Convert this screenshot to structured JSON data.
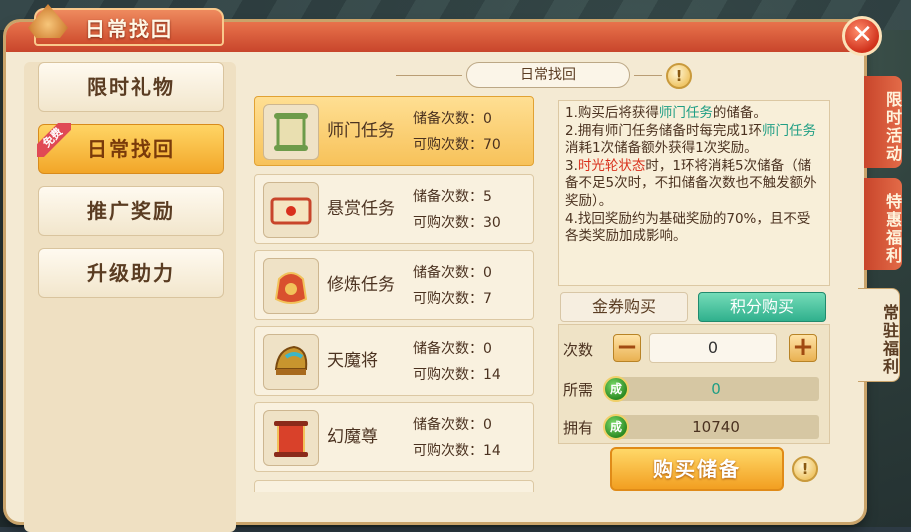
{
  "window": {
    "title": "日常找回",
    "close_symbol": "✕"
  },
  "left_menu": {
    "items": [
      {
        "label": "限时礼物",
        "active": false
      },
      {
        "label": "日常找回",
        "active": true,
        "badge": "免费"
      },
      {
        "label": "推广奖励",
        "active": false
      },
      {
        "label": "升级助力",
        "active": false
      }
    ]
  },
  "section_title": "日常找回",
  "tasks": [
    {
      "name": "师门任务",
      "stored_label": "储备次数：",
      "stored": "0",
      "buyable_label": "可购次数：",
      "buyable": "70",
      "icon": "scroll-icon",
      "active": true
    },
    {
      "name": "悬赏任务",
      "stored_label": "储备次数：",
      "stored": "5",
      "buyable_label": "可购次数：",
      "buyable": "30",
      "icon": "bounty-scroll-icon",
      "active": false
    },
    {
      "name": "修炼任务",
      "stored_label": "储备次数：",
      "stored": "0",
      "buyable_label": "可购次数：",
      "buyable": "7",
      "icon": "cultivation-pouch-icon",
      "active": false
    },
    {
      "name": "天魔将",
      "stored_label": "储备次数：",
      "stored": "0",
      "buyable_label": "可购次数：",
      "buyable": "14",
      "icon": "demon-helmet-icon",
      "active": false
    },
    {
      "name": "幻魔尊",
      "stored_label": "储备次数：",
      "stored": "0",
      "buyable_label": "可购次数：",
      "buyable": "14",
      "icon": "red-scroll-icon",
      "active": false
    }
  ],
  "description": {
    "l1a": "1.购买后将获得",
    "l1b": "师门任务",
    "l1c": "的储备。",
    "l2a": "2.拥有师门任务储备时每完成1环",
    "l2b": "师门任务",
    "l2c": "消耗1次储备额外获得1次奖励。",
    "l3a": "3.",
    "l3b": "时光轮状态",
    "l3c": "时，1环将消耗5次储备（储备不足5次时，不扣储备次数也不触发额外奖励）。",
    "l4": "4.找回奖励约为基础奖励的70%，且不受各类奖励加成影响。"
  },
  "buy_tabs": {
    "gold": "金券购买",
    "points": "积分购买",
    "active": "points"
  },
  "buy": {
    "count_label": "次数",
    "count_value": "0",
    "minus": "−",
    "plus": "+",
    "need_label": "所需",
    "need_value": "0",
    "own_label": "拥有",
    "own_value": "10740",
    "coin_glyph": "成",
    "button": "购买储备"
  },
  "side_tabs": [
    {
      "label": "限时活动",
      "active": false
    },
    {
      "label": "特惠福利",
      "active": false
    },
    {
      "label": "常驻福利",
      "active": true
    }
  ],
  "colors": {
    "accent_orange": "#f2a628",
    "teal": "#30b08d",
    "highlight_green": "#1f9e84",
    "highlight_red": "#d9301c"
  }
}
